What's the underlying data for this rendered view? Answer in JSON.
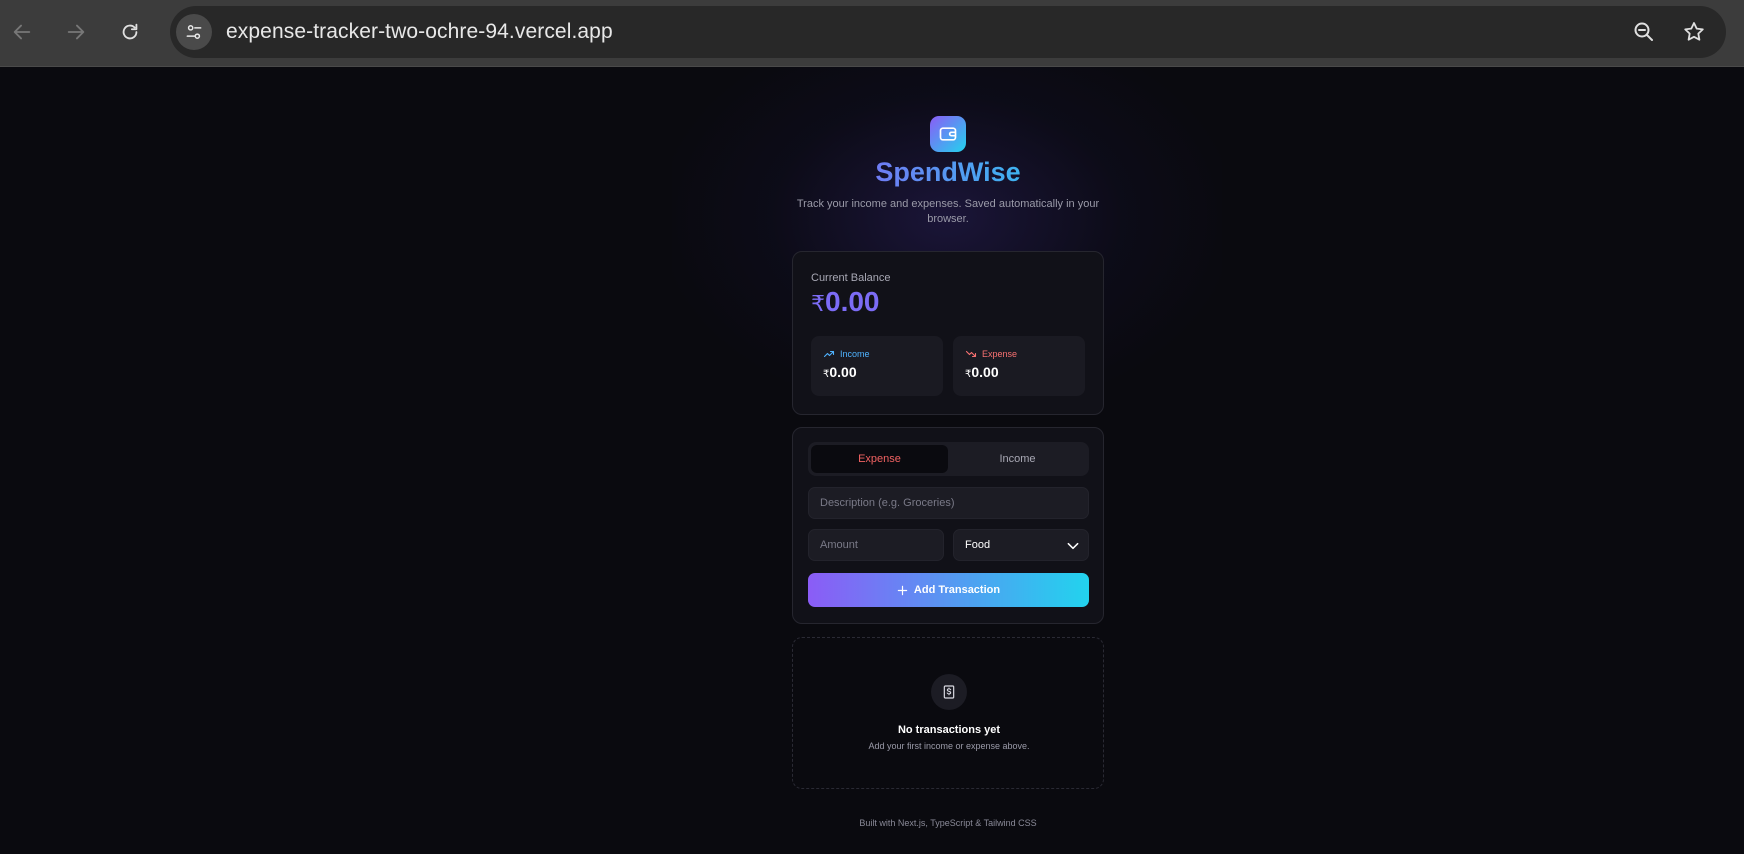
{
  "browser": {
    "url": "expense-tracker-two-ochre-94.vercel.app",
    "icons": [
      "back-arrow-icon",
      "forward-arrow-icon",
      "reload-icon",
      "site-settings-icon",
      "zoom-out-icon",
      "bookmark-star-icon"
    ]
  },
  "header": {
    "title": "SpendWise",
    "tagline": "Track your income and expenses. Saved automatically in your browser.",
    "logo_icon": "wallet-icon"
  },
  "balance": {
    "label": "Current Balance",
    "currency": "₹",
    "value": "0.00",
    "income": {
      "label": "Income",
      "currency": "₹",
      "value": "0.00",
      "icon": "trending-up-icon"
    },
    "expense": {
      "label": "Expense",
      "currency": "₹",
      "value": "0.00",
      "icon": "trending-down-icon"
    }
  },
  "form": {
    "tabs": [
      {
        "label": "Expense",
        "active": true
      },
      {
        "label": "Income",
        "active": false
      }
    ],
    "description_placeholder": "Description (e.g. Groceries)",
    "amount_placeholder": "Amount",
    "category_selected": "Food",
    "add_label": "Add Transaction"
  },
  "transactions": {
    "empty_title": "No transactions yet",
    "empty_subtitle": "Add your first income or expense above.",
    "empty_icon": "receipt-icon"
  },
  "footer": {
    "text": "Built with Next.js, TypeScript & Tailwind CSS"
  },
  "colors": {
    "accent_start": "#8b5cf6",
    "accent_end": "#22d3ee",
    "expense": "#f87171",
    "income": "#4fb3ff",
    "background": "#0a0a0f"
  }
}
